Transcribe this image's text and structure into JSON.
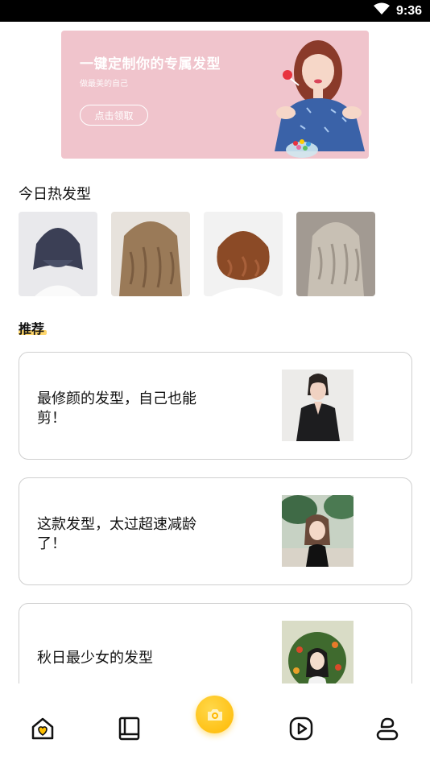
{
  "status_bar": {
    "time": "9:36",
    "icons": [
      "wifi-icon",
      "battery-icon"
    ]
  },
  "banner": {
    "title": "一键定制你的专属发型",
    "subtitle": "做最美的自己",
    "button_label": "点击领取",
    "background_color": "#f0c4cc"
  },
  "hot_section": {
    "title": "今日热发型",
    "items": [
      {
        "name": "hair-photo-1"
      },
      {
        "name": "hair-photo-2"
      },
      {
        "name": "hair-photo-3"
      },
      {
        "name": "hair-photo-4"
      }
    ]
  },
  "recommend": {
    "title": "推荐",
    "items": [
      {
        "text": "最修颜的发型，自己也能剪！"
      },
      {
        "text": "这款发型，太过超速减龄了！"
      },
      {
        "text": "秋日最少女的发型"
      }
    ]
  },
  "bottom_nav": {
    "items": [
      "home-icon",
      "book-icon",
      "camera-icon",
      "play-icon",
      "profile-icon"
    ],
    "accent_color": "#ffc000"
  }
}
